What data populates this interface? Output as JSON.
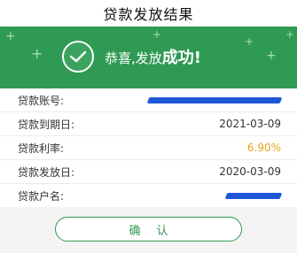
{
  "page": {
    "title": "贷款发放结果"
  },
  "banner": {
    "message_prefix": "恭喜,发放",
    "message_emphasis": "成功",
    "message_suffix": "!",
    "icon": "check-icon",
    "colors": {
      "background": "#2f9a53",
      "text": "#ffffff"
    }
  },
  "details": {
    "rows": [
      {
        "label": "贷款账号:",
        "value": "",
        "redacted": true
      },
      {
        "label": "贷款到期日:",
        "value": "2021-03-09"
      },
      {
        "label": "贷款利率:",
        "value": "6.90%",
        "highlight_color": "#e5a321"
      },
      {
        "label": "贷款发放日:",
        "value": "2020-03-09"
      },
      {
        "label": "贷款户名:",
        "value": "",
        "redacted": true
      }
    ]
  },
  "actions": {
    "confirm_label": "确认"
  }
}
